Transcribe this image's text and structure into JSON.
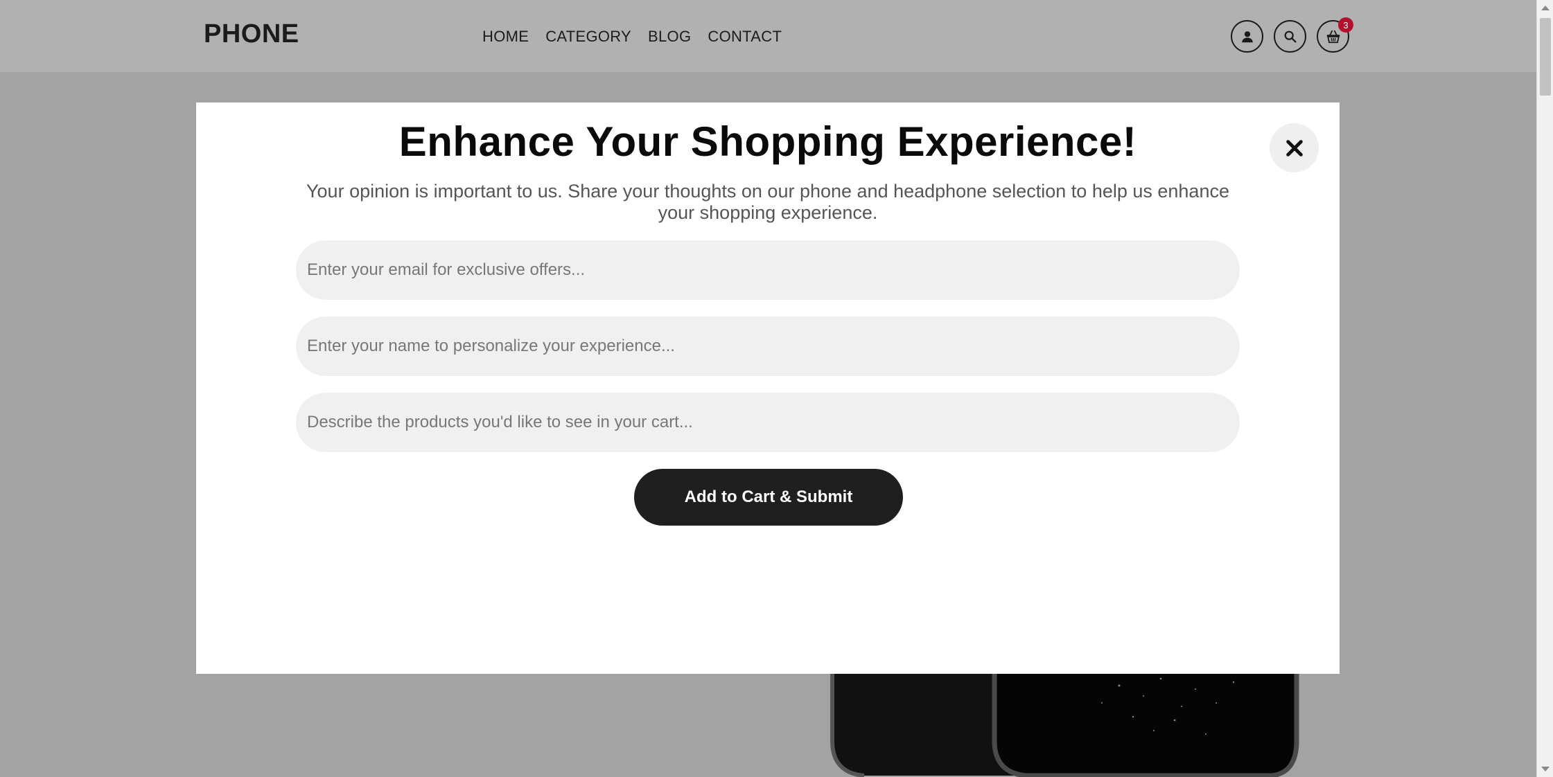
{
  "header": {
    "brand": "PHONE",
    "nav": [
      "HOME",
      "CATEGORY",
      "BLOG",
      "CONTACT"
    ],
    "cart_count": "3",
    "icons": [
      "user-icon",
      "search-icon",
      "basket-icon"
    ]
  },
  "modal": {
    "title": "Enhance Your Shopping Experience!",
    "subtitle": "Your opinion is important to us. Share your thoughts on our phone and headphone selection to help us enhance your shopping experience.",
    "email_placeholder": "Enter your email for exclusive offers...",
    "name_placeholder": "Enter your name to personalize your experience...",
    "products_placeholder": "Describe the products you'd like to see in your cart...",
    "submit_label": "Add to Cart & Submit",
    "close_icon": "close-icon"
  },
  "colors": {
    "overlay_bg": "#a3a3a3",
    "header_bg": "#b1b1b1",
    "button_dark": "#1f1f1f",
    "badge_red": "#b3102e",
    "field_bg": "#f0f0f0"
  }
}
